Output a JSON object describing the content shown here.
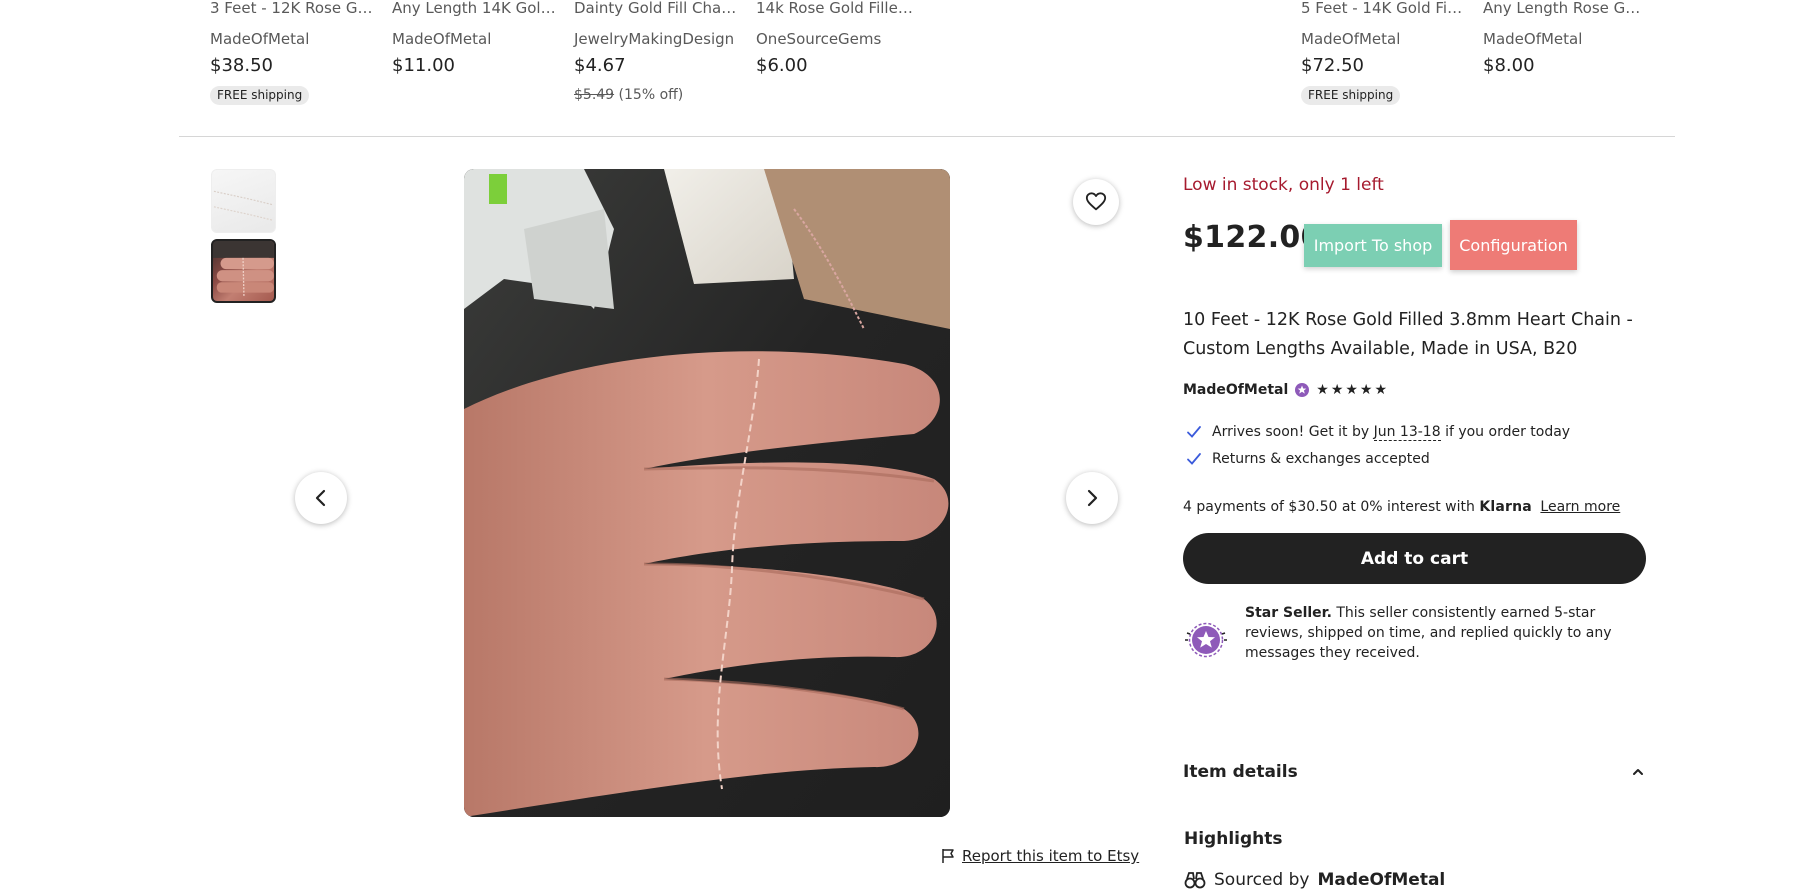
{
  "related_strip": [
    {
      "title": "3 Feet - 12K Rose Gol...",
      "shop": "MadeOfMetal",
      "price": "$38.50",
      "badge": "FREE shipping"
    },
    {
      "title": "Any Length 14K Gold...",
      "shop": "MadeOfMetal",
      "price": "$11.00"
    },
    {
      "title": "Dainty Gold Fill Chai...",
      "shop": "JewelryMakingDesign",
      "price": "$4.67",
      "original_price": "$5.49",
      "discount": "(15% off)"
    },
    {
      "title": "14k Rose Gold Filled ...",
      "shop": "OneSourceGems",
      "price": "$6.00"
    },
    {
      "title": "5 Feet - 14K Gold Fille...",
      "shop": "MadeOfMetal",
      "price": "$72.50",
      "badge": "FREE shipping"
    },
    {
      "title": "Any Length Rose Gol...",
      "shop": "MadeOfMetal",
      "price": "$8.00"
    }
  ],
  "gallery": {
    "prev_icon": "chevron-left-icon",
    "next_icon": "chevron-right-icon",
    "favorite_icon": "heart-icon",
    "report_icon": "flag-icon",
    "report_link": "Report this item to Etsy"
  },
  "product": {
    "stock_notice": "Low in stock, only 1 left",
    "price": "$122.00",
    "import_button": "Import To shop",
    "config_button": "Configuration",
    "title": "10 Feet - 12K Rose Gold Filled 3.8mm Heart Chain - Custom Lengths Available, Made in USA, B20",
    "shop_name": "MadeOfMetal",
    "rating_stars": "★★★★★",
    "perks": {
      "arrives_prefix": "Arrives soon! Get it by",
      "arrives_date": "Jun 13-18",
      "arrives_suffix": "if you order today",
      "returns": "Returns & exchanges accepted"
    },
    "klarna": {
      "text": "4 payments of $30.50 at 0% interest with",
      "brand": "Klarna",
      "learn_more": "Learn more"
    },
    "add_to_cart": "Add to cart",
    "star_seller": {
      "bold": "Star Seller.",
      "text": "This seller consistently earned 5-star reviews, shipped on time, and replied quickly to any messages they received."
    },
    "item_details": "Item details",
    "highlights": "Highlights",
    "sourced_prefix": "Sourced by",
    "sourced_shop": "MadeOfMetal"
  },
  "colors": {
    "stock_red": "#a61a2e",
    "import_green": "#7ccfb3",
    "config_red": "#ee7b76",
    "cart_black": "#222222",
    "star_seller_purple": "#8e5ab9"
  }
}
